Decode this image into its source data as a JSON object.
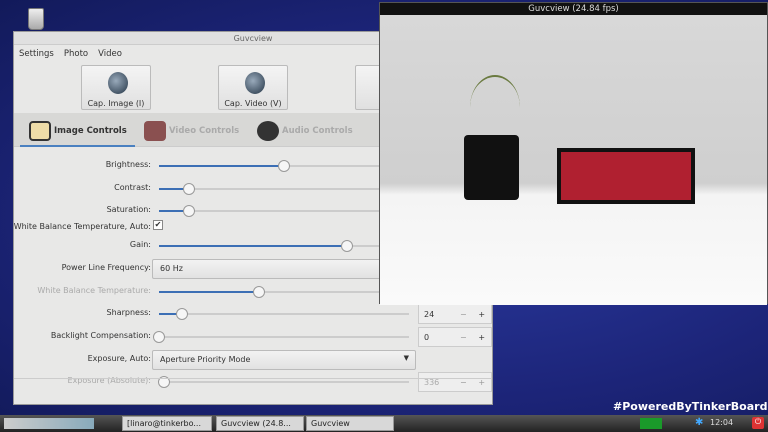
{
  "control_window": {
    "title": "Guvcview",
    "menu": [
      "Settings",
      "Photo",
      "Video"
    ],
    "buttons": {
      "cap_image": "Cap. Image (I)",
      "cap_video": "Cap. Video (V)"
    },
    "tabs": [
      "Image Controls",
      "Video Controls",
      "Audio Controls"
    ],
    "controls": {
      "brightness": {
        "label": "Brightness:",
        "value": 0.5
      },
      "contrast": {
        "label": "Contrast:",
        "value": 0.12
      },
      "saturation": {
        "label": "Saturation:",
        "value": 0.12
      },
      "wb_auto": {
        "label": "White Balance Temperature, Auto:",
        "checked": "✔"
      },
      "gain": {
        "label": "Gain:",
        "value": 0.75
      },
      "power_line": {
        "label": "Power Line Frequency:",
        "selected": "60 Hz"
      },
      "wb_temp": {
        "label": "White Balance Temperature:",
        "value": 0.4
      },
      "sharpness": {
        "label": "Sharpness:",
        "value": 0.09,
        "number": "24"
      },
      "backlight": {
        "label": "Backlight Compensation:",
        "value": 0,
        "number": "0"
      },
      "exposure_auto": {
        "label": "Exposure, Auto:",
        "selected": "Aperture Priority Mode"
      },
      "exposure_abs": {
        "label": "Exposure (Absolute):",
        "value": 0.02,
        "number": "336"
      }
    },
    "spin_minus": "−",
    "spin_plus": "+"
  },
  "preview_window": {
    "title": "Guvcview  (24.84 fps)"
  },
  "taskbar": {
    "items": [
      "[linaro@tinkerbo...",
      "Guvcview  (24.8...",
      "Guvcview"
    ],
    "clock": "12:04"
  },
  "watermark": "#PoweredByTinkerBoard"
}
